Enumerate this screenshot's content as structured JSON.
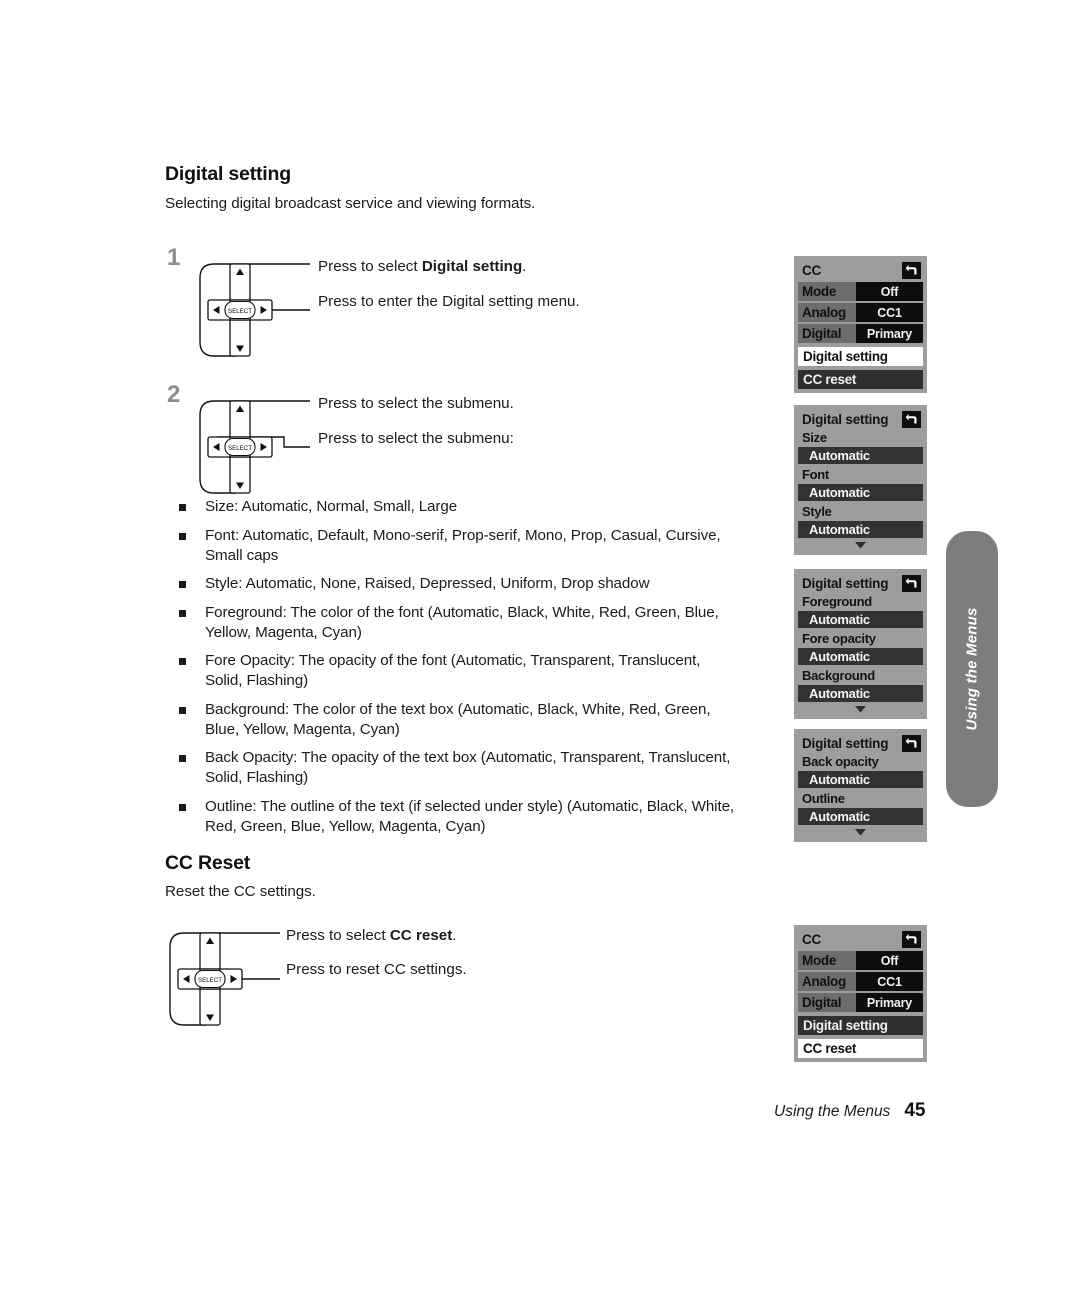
{
  "sections": {
    "digital_setting": {
      "heading": "Digital setting",
      "intro": "Selecting digital broadcast service and viewing formats."
    },
    "cc_reset": {
      "heading": "CC Reset",
      "intro": "Reset the CC settings."
    }
  },
  "steps": [
    {
      "number": "1",
      "line1_prefix": "Press to select ",
      "line1_bold": "Digital setting",
      "line1_suffix": ".",
      "line2": "Press to enter the Digital setting menu."
    },
    {
      "number": "2",
      "line1": "Press to select the submenu.",
      "line2": "Press to select the submenu:"
    }
  ],
  "cc_reset_step": {
    "line1_prefix": "Press to select ",
    "line1_bold": "CC reset",
    "line1_suffix": ".",
    "line2": "Press to reset CC settings."
  },
  "navpad": {
    "select_label": "SELECT",
    "up_icon": "triangle-up-icon",
    "down_icon": "triangle-down-icon",
    "left_icon": "triangle-left-icon",
    "right_icon": "triangle-right-icon"
  },
  "bullets": [
    "Size: Automatic, Normal, Small, Large",
    "Font: Automatic, Default, Mono-serif, Prop-serif, Mono, Prop, Casual, Cursive, Small caps",
    "Style: Automatic, None, Raised, Depressed, Uniform, Drop shadow",
    "Foreground: The color of the font (Automatic, Black, White, Red, Green, Blue, Yellow, Magenta, Cyan)",
    "Fore Opacity: The opacity of the font (Automatic, Transparent, Translucent, Solid, Flashing)",
    "Background: The color of the text box (Automatic, Black, White, Red, Green, Blue, Yellow, Magenta, Cyan)",
    "Back Opacity: The opacity of the text box (Automatic, Transparent, Translucent, Solid, Flashing)",
    "Outline: The outline of the text (if selected under style) (Automatic, Black, White, Red, Green, Blue, Yellow, Magenta, Cyan)"
  ],
  "osd_menus": {
    "cc_top": {
      "title": "CC",
      "back_icon": "back-arrow-icon",
      "rows": [
        {
          "label": "Mode",
          "value": "Off"
        },
        {
          "label": "Analog",
          "value": "CC1"
        },
        {
          "label": "Digital",
          "value": "Primary"
        }
      ],
      "item_digital_setting": "Digital setting",
      "item_cc_reset": "CC reset"
    },
    "digital_setting_1": {
      "title": "Digital setting",
      "back_icon": "back-arrow-icon",
      "items": [
        {
          "label": "Size",
          "value": "Automatic"
        },
        {
          "label": "Font",
          "value": "Automatic"
        },
        {
          "label": "Style",
          "value": "Automatic"
        }
      ],
      "more_icon": "chevron-down-icon"
    },
    "digital_setting_2": {
      "title": "Digital setting",
      "back_icon": "back-arrow-icon",
      "items": [
        {
          "label": "Foreground",
          "value": "Automatic"
        },
        {
          "label": "Fore opacity",
          "value": "Automatic"
        },
        {
          "label": "Background",
          "value": "Automatic"
        }
      ],
      "more_icon": "chevron-down-icon"
    },
    "digital_setting_3": {
      "title": "Digital setting",
      "back_icon": "back-arrow-icon",
      "items": [
        {
          "label": "Back opacity",
          "value": "Automatic"
        },
        {
          "label": "Outline",
          "value": "Automatic"
        }
      ],
      "more_icon": "chevron-down-icon"
    },
    "cc_bottom": {
      "title": "CC",
      "back_icon": "back-arrow-icon",
      "rows": [
        {
          "label": "Mode",
          "value": "Off"
        },
        {
          "label": "Analog",
          "value": "CC1"
        },
        {
          "label": "Digital",
          "value": "Primary"
        }
      ],
      "item_digital_setting": "Digital setting",
      "item_cc_reset": "CC reset"
    }
  },
  "side_tab": {
    "label": "Using the Menus"
  },
  "footer": {
    "text": "Using the Menus",
    "page": "45"
  },
  "colors": {
    "osd_background": "#9d9d9d",
    "osd_value_box": "#0d0d0d",
    "osd_selected": "#ffffff",
    "side_tab": "#7d7d7d",
    "step_number": "#8d8d8d"
  }
}
